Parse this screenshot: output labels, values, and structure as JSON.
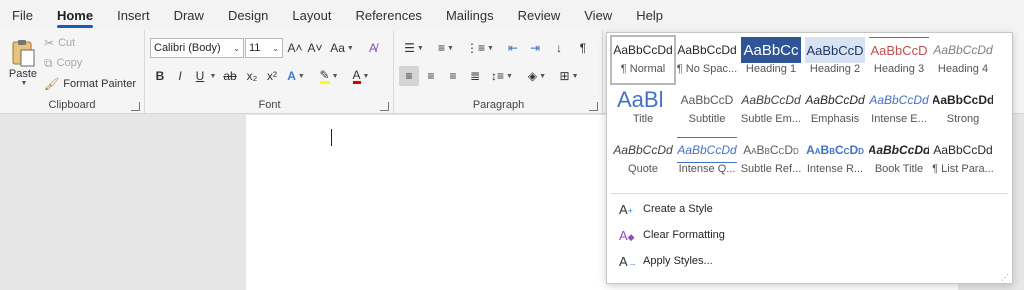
{
  "menu": {
    "tabs": [
      "File",
      "Home",
      "Insert",
      "Draw",
      "Design",
      "Layout",
      "References",
      "Mailings",
      "Review",
      "View",
      "Help"
    ],
    "active": "Home"
  },
  "clipboard": {
    "group_label": "Clipboard",
    "paste_label": "Paste",
    "cut_label": "Cut",
    "copy_label": "Copy",
    "format_painter_label": "Format Painter"
  },
  "font": {
    "group_label": "Font",
    "font_name": "Calibri (Body)",
    "font_size": "11",
    "grow_label": "A˄",
    "shrink_label": "A˅",
    "change_case_label": "Aa",
    "bold": "B",
    "italic": "I",
    "underline": "U",
    "strike": "ab",
    "subscript": "x₂",
    "superscript": "x²",
    "text_effects": "A",
    "font_color": "A"
  },
  "paragraph": {
    "group_label": "Paragraph"
  },
  "styles": {
    "tiles": [
      {
        "preview": "AaBbCcDd",
        "name": "¶ Normal"
      },
      {
        "preview": "AaBbCcDd",
        "name": "¶ No Spac..."
      },
      {
        "preview": "AaBbCc",
        "name": "Heading 1"
      },
      {
        "preview": "AaBbCcD",
        "name": "Heading 2"
      },
      {
        "preview": "AaBbCcD",
        "name": "Heading 3"
      },
      {
        "preview": "AaBbCcDd",
        "name": "Heading 4"
      },
      {
        "preview": "AaBl",
        "name": "Title"
      },
      {
        "preview": "AaBbCcD",
        "name": "Subtitle"
      },
      {
        "preview": "AaBbCcDd",
        "name": "Subtle Em..."
      },
      {
        "preview": "AaBbCcDd",
        "name": "Emphasis"
      },
      {
        "preview": "AaBbCcDd",
        "name": "Intense E..."
      },
      {
        "preview": "AaBbCcDd",
        "name": "Strong"
      },
      {
        "preview": "AaBbCcDd",
        "name": "Quote"
      },
      {
        "preview": "AaBbCcDd",
        "name": "Intense Q..."
      },
      {
        "preview": "AaBbCcDd",
        "name": "Subtle Ref..."
      },
      {
        "preview": "AaBbCcDd",
        "name": "Intense R..."
      },
      {
        "preview": "AaBbCcDd",
        "name": "Book Title"
      },
      {
        "preview": "AaBbCcDd",
        "name": "¶ List Para..."
      }
    ],
    "create_label": "Create a Style",
    "clear_label": "Clear Formatting",
    "apply_label": "Apply Styles..."
  },
  "colors": {
    "accent": "#185abd",
    "highlight": "#ffff00",
    "font_color": "#e00000"
  }
}
